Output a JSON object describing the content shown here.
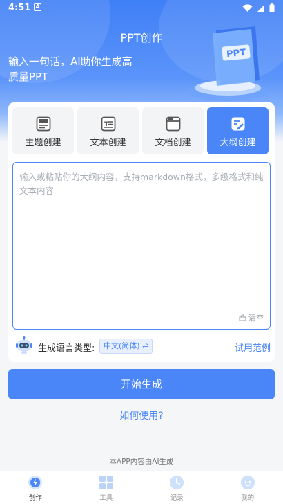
{
  "status_bar": {
    "time": "4:51",
    "notification_glyph": "A",
    "icons": [
      "wifi-icon",
      "signal-icon",
      "battery-icon"
    ]
  },
  "header": {
    "title": "PPT创作",
    "slogan": "输入一句话，AI助你生成高质量PPT",
    "illustration_text": "PPT"
  },
  "mode_tabs": [
    {
      "label": "主题创建",
      "icon": "theme-doc-icon",
      "active": false
    },
    {
      "label": "文本创建",
      "icon": "text-doc-icon",
      "active": false
    },
    {
      "label": "文档创建",
      "icon": "file-icon",
      "active": false
    },
    {
      "label": "大纲创建",
      "icon": "outline-edit-icon",
      "active": true
    }
  ],
  "editor": {
    "value": "",
    "placeholder": "输入或粘贴你的大纲内容，支持markdown格式，多级格式和纯文本内容",
    "clear_label": "清空"
  },
  "language": {
    "label": "生成语言类型:",
    "selected": "中文(简体)",
    "try_example": "试用范例"
  },
  "actions": {
    "start": "开始生成",
    "howto": "如何使用?"
  },
  "footer_note": "本APP内容由AI生成",
  "bottom_nav": [
    {
      "label": "创作",
      "icon": "creation-icon",
      "active": true
    },
    {
      "label": "工具",
      "icon": "tools-grid-icon",
      "active": false
    },
    {
      "label": "记录",
      "icon": "clock-icon",
      "active": false
    },
    {
      "label": "我的",
      "icon": "profile-icon",
      "active": false
    }
  ],
  "colors": {
    "accent": "#4a86f7",
    "hero_top": "#3f7ff7",
    "background": "#f5f6f8"
  }
}
